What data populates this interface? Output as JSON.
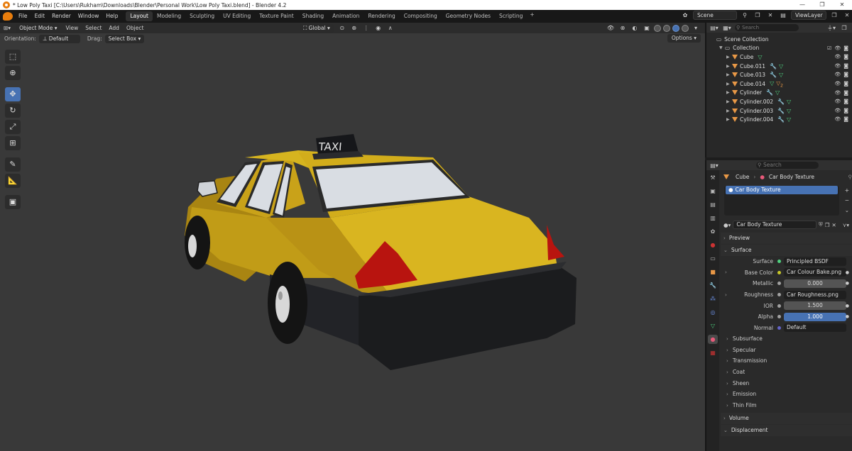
{
  "titlebar": {
    "title": "* Low Poly Taxi [C:\\Users\\Rukham\\Downloads\\Blender\\Personal Work\\Low Poly Taxi.blend] - Blender 4.2",
    "minimize": "—",
    "maximize": "❐",
    "close": "✕"
  },
  "menu": {
    "items": [
      "File",
      "Edit",
      "Render",
      "Window",
      "Help"
    ],
    "workspaces": [
      "Layout",
      "Modeling",
      "Sculpting",
      "UV Editing",
      "Texture Paint",
      "Shading",
      "Animation",
      "Rendering",
      "Compositing",
      "Geometry Nodes",
      "Scripting"
    ],
    "active_workspace": "Layout",
    "add_workspace": "+",
    "scene": "Scene",
    "view_layer": "ViewLayer"
  },
  "viewport": {
    "mode": "Object Mode",
    "menus": [
      "View",
      "Select",
      "Add",
      "Object"
    ],
    "transform_orientation": "Global",
    "orientation_label": "Orientation:",
    "orientation_value": "Default",
    "drag_label": "Drag:",
    "drag_value": "Select Box",
    "options": "Options"
  },
  "car": {
    "sign_text": "TAXI",
    "colors": {
      "body_light": "#d6b41f",
      "body_mid": "#c9a219",
      "body_dark": "#a98512",
      "glass": "#d9dde3",
      "bumper": "#1b1c1e",
      "light": "#b8140f",
      "tire": "#141414",
      "rim": "#d8d8d8"
    }
  },
  "outliner": {
    "search_placeholder": "Search",
    "root": "Scene Collection",
    "collection": "Collection",
    "objects": [
      {
        "name": "Cube",
        "modifier": false,
        "extra": ""
      },
      {
        "name": "Cube.011",
        "modifier": true,
        "extra": ""
      },
      {
        "name": "Cube.013",
        "modifier": true,
        "extra": ""
      },
      {
        "name": "Cube.014",
        "modifier": false,
        "extra": "2"
      },
      {
        "name": "Cylinder",
        "modifier": true,
        "extra": ""
      },
      {
        "name": "Cylinder.002",
        "modifier": true,
        "extra": ""
      },
      {
        "name": "Cylinder.003",
        "modifier": true,
        "extra": ""
      },
      {
        "name": "Cylinder.004",
        "modifier": true,
        "extra": ""
      }
    ]
  },
  "properties": {
    "search_placeholder": "Search",
    "breadcrumb_object": "Cube",
    "breadcrumb_material": "Car Body Texture",
    "slot": "Car Body Texture",
    "material_name": "Car Body Texture",
    "sections": {
      "preview": "Preview",
      "surface": "Surface",
      "volume": "Volume",
      "displacement": "Displacement"
    },
    "surface_rows": [
      {
        "label": "Surface",
        "value": "Principled BSDF",
        "style": "socket",
        "expand": false,
        "dot": "#4fd17f"
      },
      {
        "label": "Base Color",
        "value": "Car Colour Bake.png",
        "style": "socket",
        "expand": true,
        "dot": "#c7c729"
      },
      {
        "label": "Metallic",
        "value": "0.000",
        "style": "num",
        "expand": false,
        "dot": "#a1a1a1"
      },
      {
        "label": "Roughness",
        "value": "Car Roughness.png",
        "style": "socket",
        "expand": true,
        "dot": "#a1a1a1"
      },
      {
        "label": "IOR",
        "value": "1.500",
        "style": "num",
        "expand": false,
        "dot": "#a1a1a1"
      },
      {
        "label": "Alpha",
        "value": "1.000",
        "style": "blue",
        "expand": false,
        "dot": "#a1a1a1"
      },
      {
        "label": "Normal",
        "value": "Default",
        "style": "plain",
        "expand": false,
        "dot": "#6363c7"
      }
    ],
    "subsections": [
      "Subsurface",
      "Specular",
      "Transmission",
      "Coat",
      "Sheen",
      "Emission",
      "Thin Film"
    ]
  }
}
